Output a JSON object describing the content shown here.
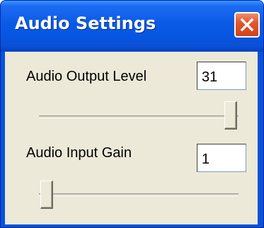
{
  "window": {
    "title": "Audio Settings"
  },
  "output": {
    "label": "Audio Output Level",
    "value": "31",
    "slider_level": 1.0
  },
  "input": {
    "label": "Audio Input Gain",
    "value": "1",
    "slider_level": 0.0
  },
  "colors": {
    "titlebar": "#0a5ae6",
    "close": "#e2582f",
    "client": "#ece9d8"
  },
  "icons": {
    "close": "close-x-icon"
  }
}
